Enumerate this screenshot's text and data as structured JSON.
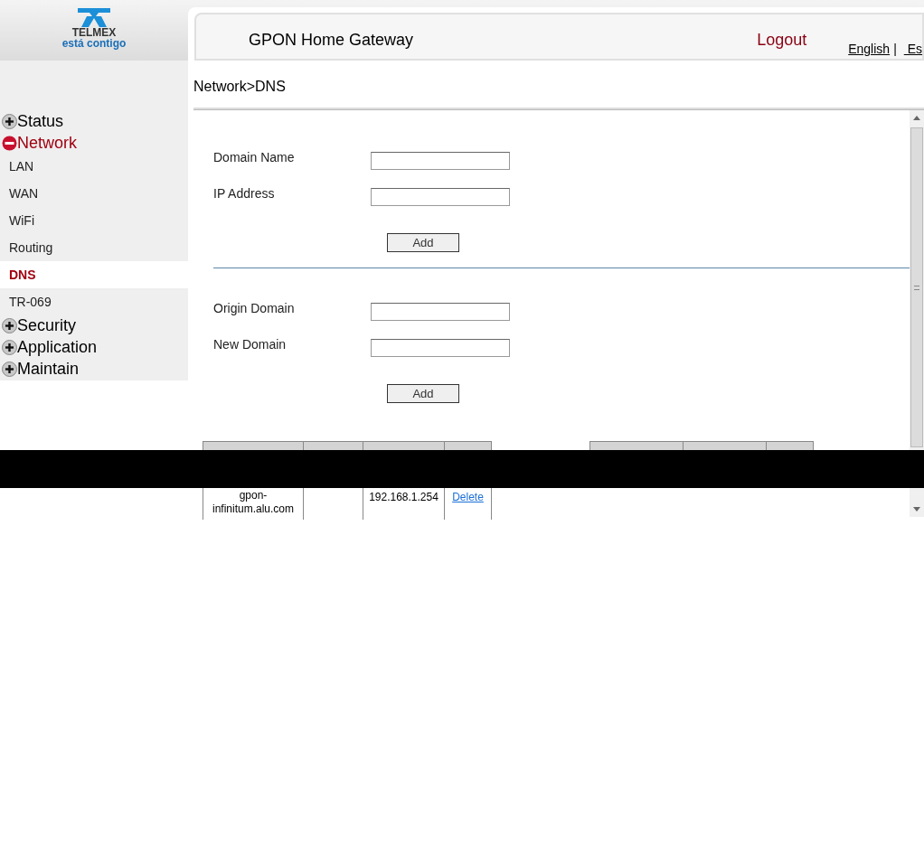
{
  "header": {
    "brand": "TELMEX",
    "tagline": "está contigo",
    "title": "GPON Home Gateway",
    "logout": "Logout",
    "languages": [
      {
        "label": "English"
      },
      {
        "label": "Es"
      }
    ],
    "separator": "|"
  },
  "sidebar": {
    "items": [
      {
        "label": "Status",
        "expanded": false
      },
      {
        "label": "Network",
        "expanded": true,
        "children": [
          {
            "label": "LAN",
            "selected": false
          },
          {
            "label": "WAN",
            "selected": false
          },
          {
            "label": "WiFi",
            "selected": false
          },
          {
            "label": "Routing",
            "selected": false
          },
          {
            "label": "DNS",
            "selected": true
          },
          {
            "label": "TR-069",
            "selected": false
          }
        ]
      },
      {
        "label": "Security",
        "expanded": false
      },
      {
        "label": "Application",
        "expanded": false
      },
      {
        "label": "Maintain",
        "expanded": false
      }
    ]
  },
  "breadcrumb": "Network>DNS",
  "forms": [
    {
      "fields": [
        {
          "label": "Domain Name"
        },
        {
          "label": "IP Address"
        }
      ],
      "button": "Add"
    },
    {
      "fields": [
        {
          "label": "Origin Domain"
        },
        {
          "label": "New Domain"
        }
      ],
      "button": "Add"
    }
  ],
  "host_table": {
    "rows": [
      {
        "domain": "gpon-infinitum.alu.com",
        "ip": "192.168.1.254",
        "action": "Delete"
      }
    ]
  }
}
